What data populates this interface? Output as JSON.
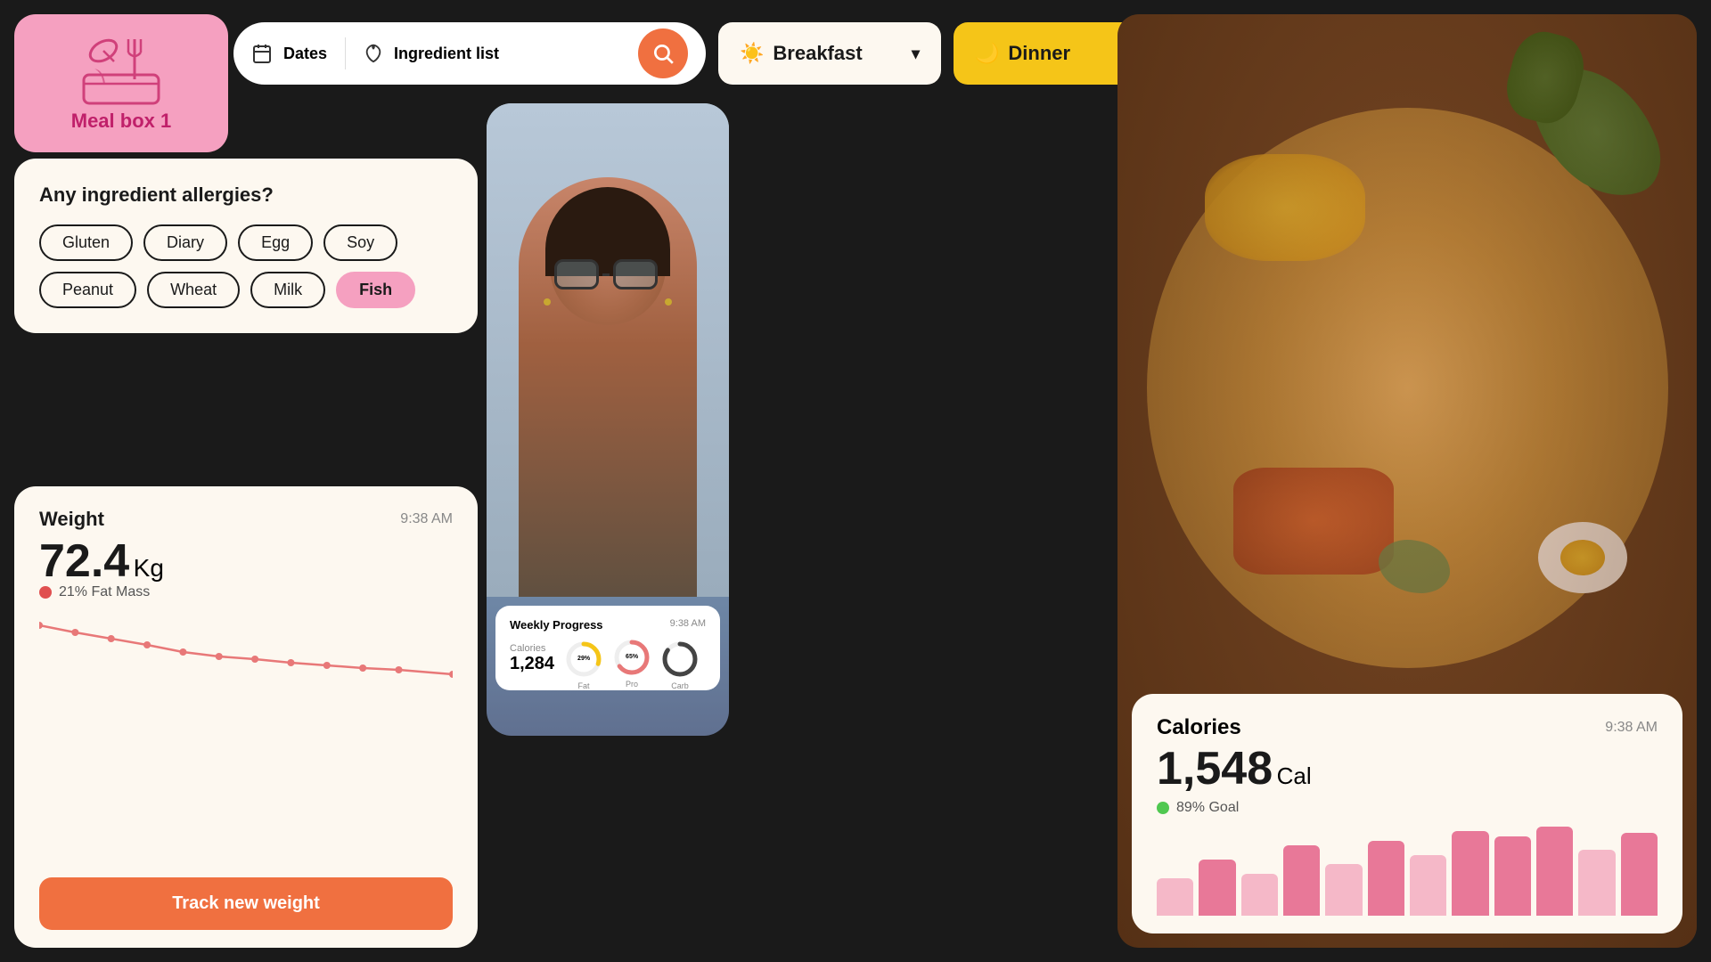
{
  "app": {
    "background": "#1a1a1a"
  },
  "header": {
    "dates_label": "Dates",
    "ingredient_label": "Ingredient list",
    "search_placeholder": "Search",
    "breakfast_label": "Breakfast",
    "dinner_label": "Dinner"
  },
  "meal_box": {
    "label": "Meal box 1"
  },
  "allergies": {
    "title": "Any ingredient allergies?",
    "tags": [
      {
        "label": "Gluten",
        "selected": false
      },
      {
        "label": "Diary",
        "selected": false
      },
      {
        "label": "Egg",
        "selected": false
      },
      {
        "label": "Soy",
        "selected": false
      },
      {
        "label": "Peanut",
        "selected": false
      },
      {
        "label": "Wheat",
        "selected": false
      },
      {
        "label": "Milk",
        "selected": false
      },
      {
        "label": "Fish",
        "selected": true
      }
    ]
  },
  "weight": {
    "title": "Weight",
    "time": "9:38 AM",
    "value": "72.4",
    "unit": "Kg",
    "fat_label": "21% Fat Mass",
    "track_button": "Track new weight"
  },
  "weekly_progress": {
    "title": "Weekly Progress",
    "time": "9:38 AM",
    "calories_label": "Calories",
    "calories_value": "1,284",
    "fat_pct": "29%",
    "fat_label": "Fat",
    "pro_pct": "65%",
    "pro_label": "Pro",
    "carb_pct": "85%",
    "carb_label": "Carb"
  },
  "calories": {
    "title": "Calories",
    "time": "9:38 AM",
    "value": "1,548",
    "unit": "Cal",
    "goal_label": "89% Goal",
    "bars": [
      40,
      60,
      45,
      75,
      55,
      80,
      65,
      90,
      85,
      95,
      70,
      88
    ]
  }
}
